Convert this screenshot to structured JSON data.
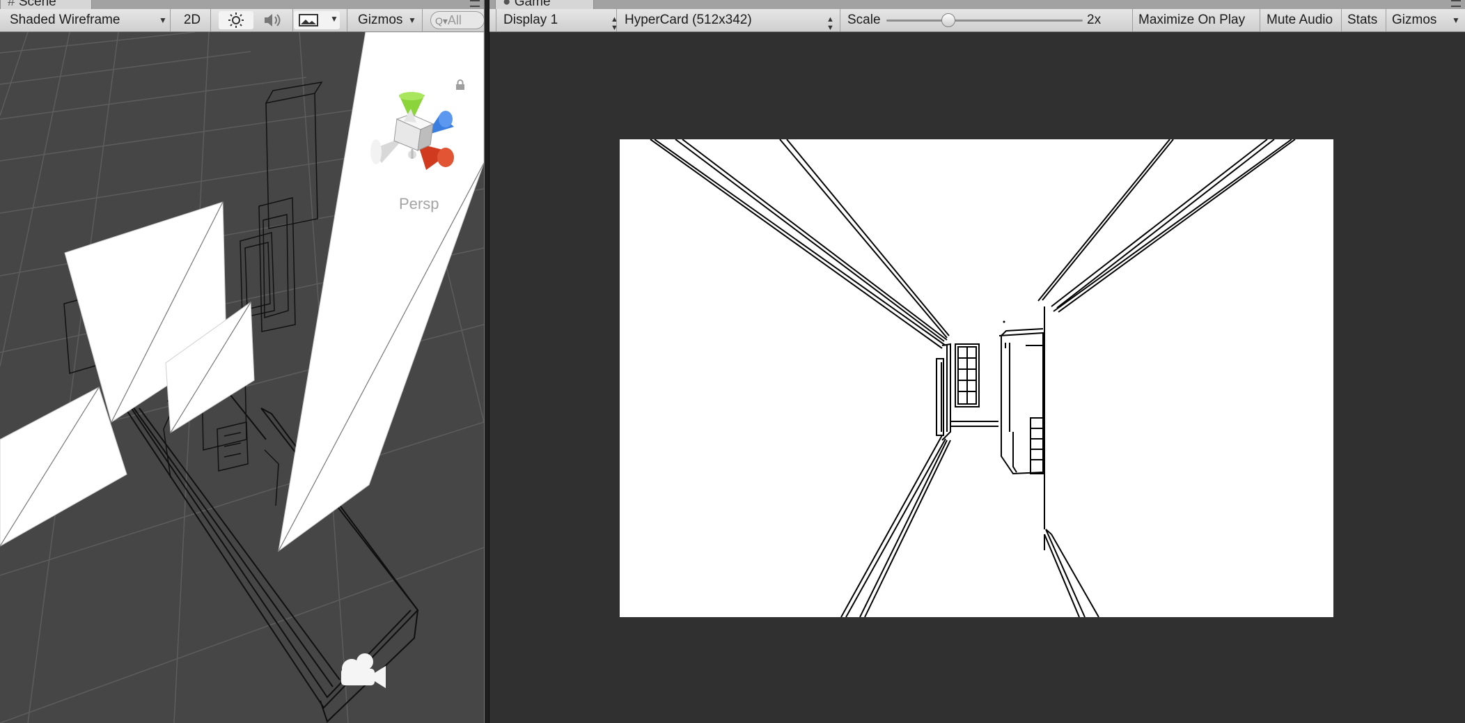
{
  "scene": {
    "tab_title": "Scene",
    "draw_mode": "Shaded Wireframe",
    "mode_2d_label": "2D",
    "gizmos_label": "Gizmos",
    "search_placeholder": "All",
    "projection_label": "Persp",
    "icons": [
      "lighting-icon",
      "audio-icon",
      "effects-icon",
      "lock-icon",
      "menu-icon",
      "camera-icon"
    ]
  },
  "game": {
    "tab_title": "Game",
    "display_label": "Display 1",
    "resolution_label": "HyperCard (512x342)",
    "scale_label": "Scale",
    "scale_value": "2x",
    "scale_fraction": 0.3,
    "maximize_label": "Maximize On Play",
    "mute_label": "Mute Audio",
    "stats_label": "Stats",
    "gizmos_label": "Gizmos"
  },
  "colors": {
    "toolbar_bg": "#dadada",
    "scene_bg": "#464646",
    "game_bg": "#303030",
    "gizmo_y": "#8bd43a",
    "gizmo_z": "#3a7fe0",
    "gizmo_x": "#d03a1e"
  }
}
